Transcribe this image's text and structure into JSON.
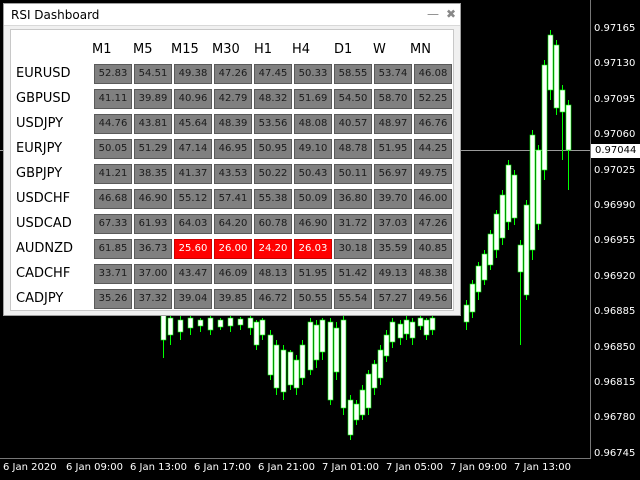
{
  "panel": {
    "title": "RSI Dashboard",
    "minimize_icon": "minimize-icon",
    "close_icon": "close-icon"
  },
  "timeframes": [
    "M1",
    "M5",
    "M15",
    "M30",
    "H1",
    "H4",
    "D1",
    "W",
    "MN"
  ],
  "rows": [
    {
      "symbol": "EURUSD",
      "values": [
        "52.83",
        "54.51",
        "49.38",
        "47.26",
        "47.45",
        "50.33",
        "58.55",
        "53.74",
        "46.08"
      ]
    },
    {
      "symbol": "GBPUSD",
      "values": [
        "41.11",
        "39.89",
        "40.96",
        "42.79",
        "48.32",
        "51.69",
        "54.50",
        "58.70",
        "52.25"
      ]
    },
    {
      "symbol": "USDJPY",
      "values": [
        "44.76",
        "43.81",
        "45.64",
        "48.39",
        "53.56",
        "48.08",
        "40.57",
        "48.97",
        "46.76"
      ]
    },
    {
      "symbol": "EURJPY",
      "values": [
        "50.05",
        "51.29",
        "47.14",
        "46.95",
        "50.95",
        "49.10",
        "48.78",
        "51.95",
        "44.25"
      ]
    },
    {
      "symbol": "GBPJPY",
      "values": [
        "41.21",
        "38.35",
        "41.37",
        "43.53",
        "50.22",
        "50.43",
        "50.11",
        "56.97",
        "49.75"
      ]
    },
    {
      "symbol": "USDCHF",
      "values": [
        "46.68",
        "46.90",
        "55.12",
        "57.41",
        "55.38",
        "50.09",
        "36.80",
        "39.70",
        "46.00"
      ]
    },
    {
      "symbol": "USDCAD",
      "values": [
        "67.33",
        "61.93",
        "64.03",
        "64.20",
        "60.78",
        "46.90",
        "31.72",
        "37.03",
        "47.26"
      ]
    },
    {
      "symbol": "AUDNZD",
      "values": [
        "61.85",
        "36.73",
        "25.60",
        "26.00",
        "24.20",
        "26.03",
        "30.18",
        "35.59",
        "40.85"
      ],
      "alerts": [
        2,
        3,
        4,
        5
      ]
    },
    {
      "symbol": "CADCHF",
      "values": [
        "33.71",
        "37.00",
        "43.47",
        "46.09",
        "48.13",
        "51.95",
        "51.42",
        "49.13",
        "48.38"
      ]
    },
    {
      "symbol": "CADJPY",
      "values": [
        "35.26",
        "37.32",
        "39.04",
        "39.85",
        "46.72",
        "50.55",
        "55.54",
        "57.27",
        "49.56"
      ]
    }
  ],
  "chart": {
    "price_labels": [
      "0.97165",
      "0.97130",
      "0.97095",
      "0.97060",
      "0.97025",
      "0.96990",
      "0.96955",
      "0.96920",
      "0.96885",
      "0.96850",
      "0.96815",
      "0.96780",
      "0.96745"
    ],
    "current_price": "0.97044",
    "time_labels": [
      "6 Jan 2020",
      "6 Jan 09:00",
      "6 Jan 13:00",
      "6 Jan 17:00",
      "6 Jan 21:00",
      "7 Jan 01:00",
      "7 Jan 05:00",
      "7 Jan 09:00",
      "7 Jan 13:00"
    ],
    "candle_up_color": "#ffffff",
    "candle_wick_color": "#00ff00",
    "dashboard_alert_color": "#ff0000"
  }
}
